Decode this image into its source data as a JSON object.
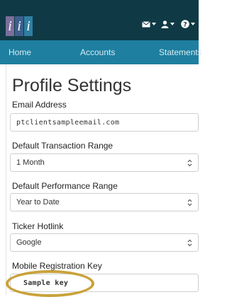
{
  "header": {
    "logo_letters": [
      "i",
      "i",
      "i"
    ],
    "logo_colors": [
      "#7a6e9c",
      "#3e5f8c",
      "#2f7fa2"
    ],
    "icons": [
      "mail-icon",
      "user-icon",
      "help-icon"
    ]
  },
  "nav": {
    "items": [
      "Home",
      "Accounts",
      "Statements"
    ]
  },
  "page": {
    "title": "Profile Settings"
  },
  "form": {
    "email_label": "Email Address",
    "email_value": "ptclientsampleemail.com",
    "transaction_label": "Default Transaction Range",
    "transaction_value": "1 Month",
    "performance_label": "Default Performance Range",
    "performance_value": "Year to Date",
    "ticker_label": "Ticker Hotlink",
    "ticker_value": "Google",
    "mobile_key_label": "Mobile Registration Key",
    "mobile_key_value": "Sample key"
  },
  "colors": {
    "topbar": "#0f3a45",
    "navbar": "#1e7fa0",
    "highlight": "#c9a23a"
  }
}
